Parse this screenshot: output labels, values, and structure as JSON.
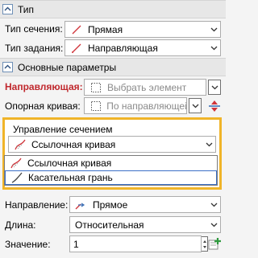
{
  "type_section": {
    "title": "Тип",
    "section_type_label": "Тип сечения:",
    "section_type_value": "Прямая",
    "task_type_label": "Тип задания:",
    "task_type_value": "Направляющая"
  },
  "main_params": {
    "title": "Основные параметры",
    "guide_label": "Направляющая:",
    "guide_placeholder": "Выбрать элемент",
    "support_curve_label": "Опорная кривая:",
    "support_curve_value": "По направляющей"
  },
  "section_control": {
    "title": "Управление сечением",
    "selected_value": "Ссылочная кривая",
    "options": [
      "Ссылочная кривая",
      "Касательная грань"
    ]
  },
  "direction": {
    "label": "Направление:",
    "value": "Прямое"
  },
  "length": {
    "label": "Длина:",
    "value": "Относительная"
  },
  "value_field": {
    "label": "Значение:",
    "value": "1"
  },
  "colors": {
    "accent_border": "#f0b429",
    "required_label": "#c0282d",
    "selection_border": "#3c70c7"
  }
}
